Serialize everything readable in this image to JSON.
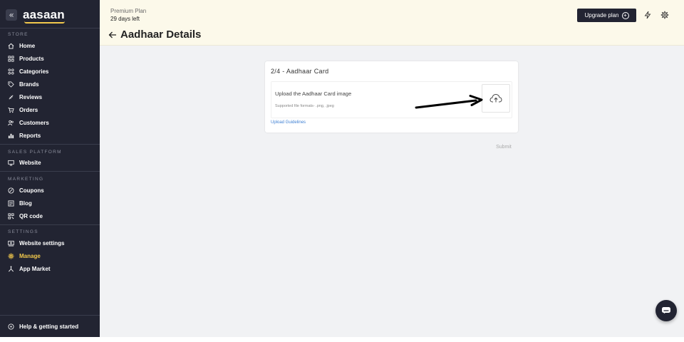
{
  "sidebar": {
    "logo": "aasaan",
    "collapse_glyph": "«",
    "sections": [
      {
        "label": "STORE",
        "items": [
          "Home",
          "Products",
          "Categories",
          "Brands",
          "Reviews",
          "Orders",
          "Customers",
          "Reports"
        ]
      },
      {
        "label": "SALES PLATFORM",
        "items": [
          "Website"
        ]
      },
      {
        "label": "MARKETING",
        "items": [
          "Coupons",
          "Blog",
          "QR code"
        ]
      },
      {
        "label": "SETTINGS",
        "items": [
          "Website settings",
          "Manage",
          "App Market"
        ]
      }
    ],
    "active_item": "Manage",
    "footer_item": "Help & getting started",
    "icons": [
      "home-icon",
      "products-icon",
      "categories-icon",
      "tag-icon",
      "reviews-icon",
      "cart-icon",
      "customers-icon",
      "reports-icon",
      "monitor-icon",
      "coupon-icon",
      "blog-icon",
      "qr-icon",
      "settings-card-icon",
      "gear-icon",
      "app-market-icon",
      "help-icon"
    ]
  },
  "header": {
    "plan_name": "Premium Plan",
    "plan_days": "29 days left",
    "page_title": "Aadhaar Details",
    "upgrade_label": "Upgrade plan",
    "icons": [
      "back-arrow-icon",
      "plus-circle-icon",
      "lightning-icon",
      "gear-icon"
    ]
  },
  "card": {
    "title": "2/4 - Aadhaar Card",
    "upload_label": "Upload the Aadhaar Card image",
    "formats": "Supported file formats- .png, .jpeg",
    "guidelines_link": "Upload Guidelines",
    "upload_icon": "cloud-upload-icon"
  },
  "submit_label": "Submit",
  "chat_icon": "chat-icon",
  "colors": {
    "sidebar_bg": "#222432",
    "accent_yellow": "#f2c94c",
    "header_bg": "#fcf9ea",
    "content_bg": "#f1f2f4",
    "link_blue": "#3d7fd3"
  }
}
